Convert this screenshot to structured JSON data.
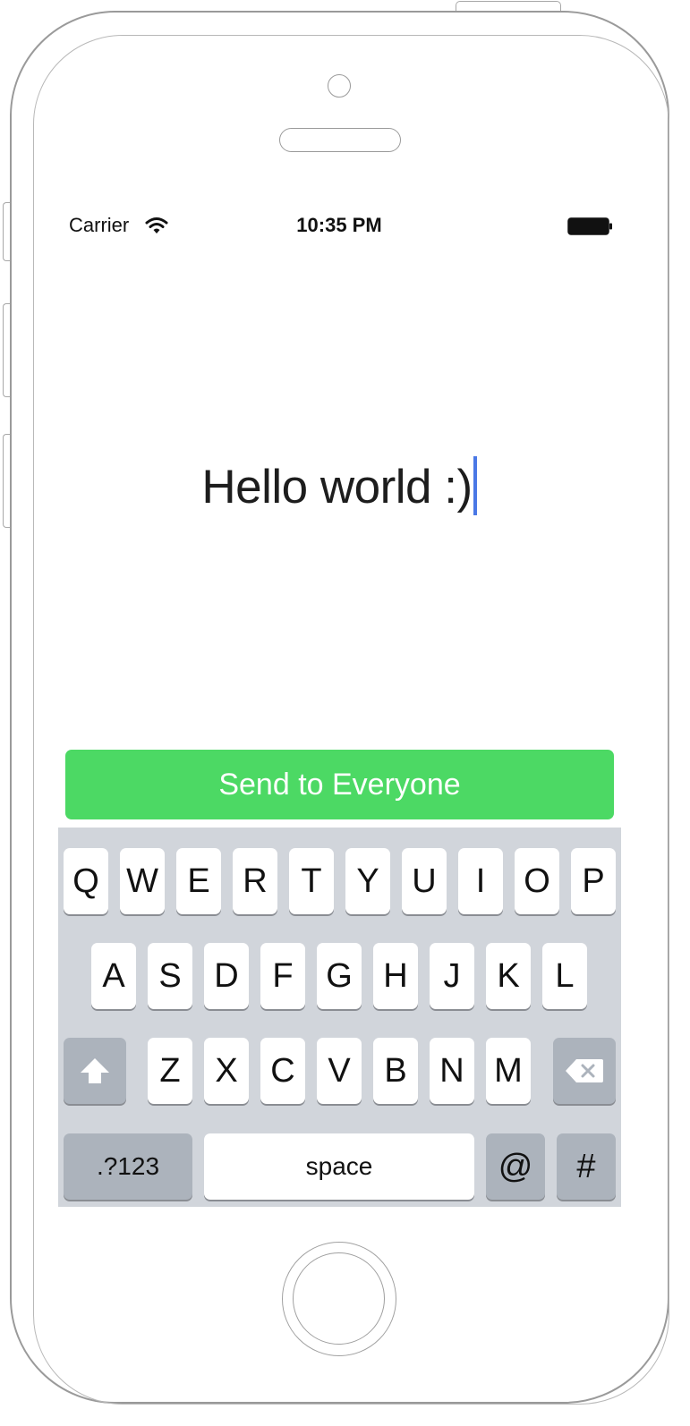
{
  "status_bar": {
    "carrier": "Carrier",
    "time": "10:35 PM",
    "wifi_icon": "wifi-icon",
    "battery_icon": "battery-full-icon"
  },
  "message": {
    "text": "Hello world :)"
  },
  "send_button": {
    "label": "Send to Everyone",
    "color": "#4cd964"
  },
  "keyboard": {
    "row1": [
      "Q",
      "W",
      "E",
      "R",
      "T",
      "Y",
      "U",
      "I",
      "O",
      "P"
    ],
    "row2": [
      "A",
      "S",
      "D",
      "F",
      "G",
      "H",
      "J",
      "K",
      "L"
    ],
    "row3": [
      "Z",
      "X",
      "C",
      "V",
      "B",
      "N",
      "M"
    ],
    "shift_icon": "shift-arrow-icon",
    "delete_icon": "backspace-icon",
    "numbers_label": ".?123",
    "space_label": "space",
    "at_label": "@",
    "hash_label": "#",
    "background_color": "#d1d5db",
    "caret_color": "#4a78e6"
  }
}
